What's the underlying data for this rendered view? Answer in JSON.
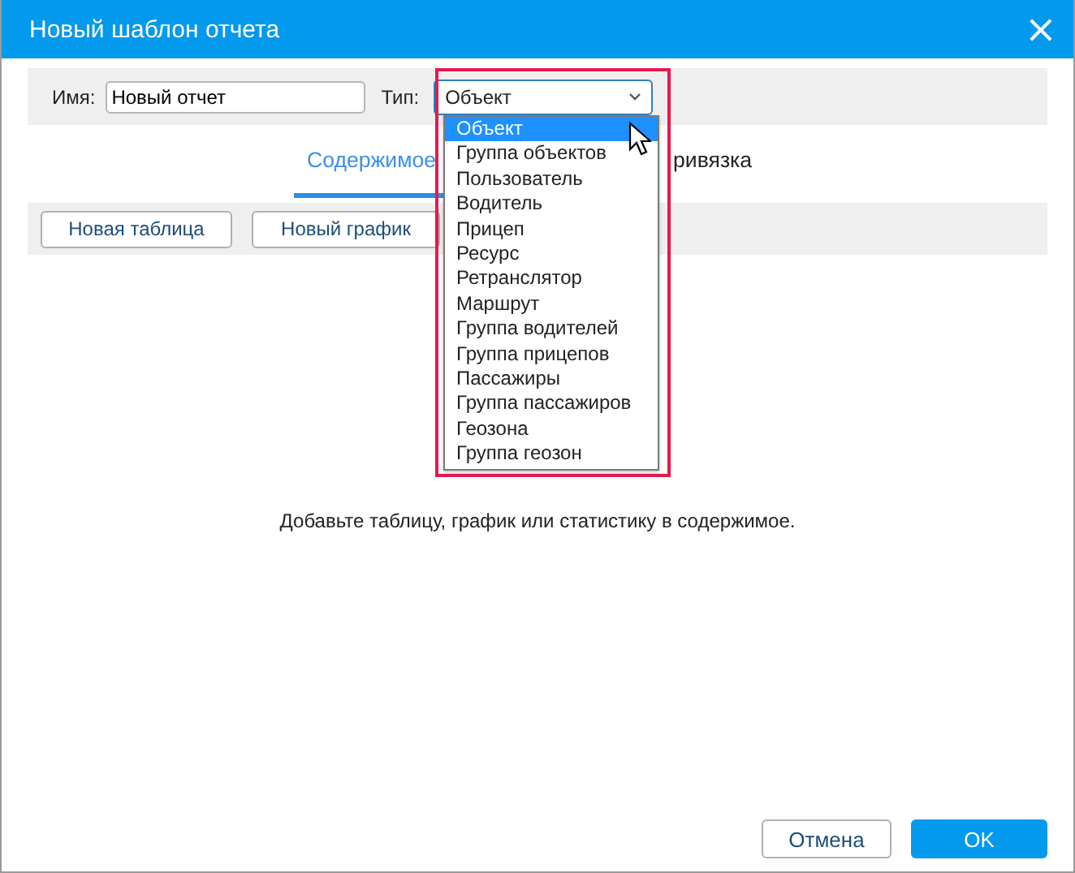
{
  "window": {
    "title": "Новый шаблон отчета",
    "close": "×"
  },
  "name_field": {
    "label": "Имя:",
    "value": "Новый отчет"
  },
  "type_field": {
    "label": "Тип:",
    "value": "Объект",
    "expanded": true,
    "options": [
      {
        "label": "Объект",
        "selected": true
      },
      {
        "label": "Группа объектов",
        "selected": false
      },
      {
        "label": "Пользователь",
        "selected": false
      },
      {
        "label": "Водитель",
        "selected": false
      },
      {
        "label": "Прицеп",
        "selected": false
      },
      {
        "label": "Ресурс",
        "selected": false
      },
      {
        "label": "Ретранслятор",
        "selected": false
      },
      {
        "label": "Маршрут",
        "selected": false
      },
      {
        "label": "Группа водителей",
        "selected": false
      },
      {
        "label": "Группа прицепов",
        "selected": false
      },
      {
        "label": "Пассажиры",
        "selected": false
      },
      {
        "label": "Группа пассажиров",
        "selected": false
      },
      {
        "label": "Геозона",
        "selected": false
      },
      {
        "label": "Группа геозон",
        "selected": false
      }
    ]
  },
  "tabs": [
    {
      "label": "Содержимое",
      "selected": true
    },
    {
      "label": "ривязка",
      "selected": false
    }
  ],
  "toolbar": [
    "Новая таблица",
    "Новый график"
  ],
  "empty_message": "Добавьте таблицу, график или статистику в содержимое.",
  "buttons": [
    {
      "label": "Отмена",
      "kind": "secondary"
    },
    {
      "label": "OK",
      "kind": "primary"
    }
  ]
}
